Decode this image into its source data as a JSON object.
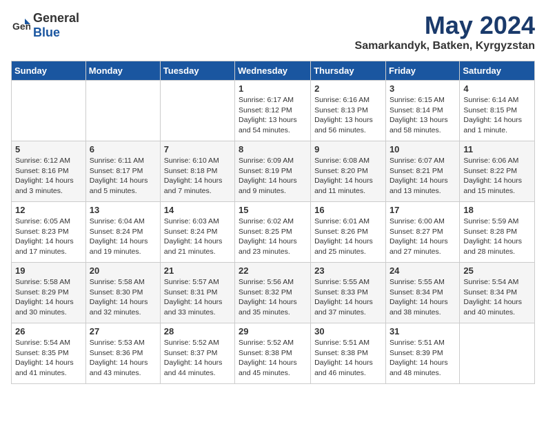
{
  "header": {
    "logo_general": "General",
    "logo_blue": "Blue",
    "month": "May 2024",
    "location": "Samarkandyk, Batken, Kyrgyzstan"
  },
  "weekdays": [
    "Sunday",
    "Monday",
    "Tuesday",
    "Wednesday",
    "Thursday",
    "Friday",
    "Saturday"
  ],
  "weeks": [
    [
      {
        "day": "",
        "info": ""
      },
      {
        "day": "",
        "info": ""
      },
      {
        "day": "",
        "info": ""
      },
      {
        "day": "1",
        "info": "Sunrise: 6:17 AM\nSunset: 8:12 PM\nDaylight: 13 hours\nand 54 minutes."
      },
      {
        "day": "2",
        "info": "Sunrise: 6:16 AM\nSunset: 8:13 PM\nDaylight: 13 hours\nand 56 minutes."
      },
      {
        "day": "3",
        "info": "Sunrise: 6:15 AM\nSunset: 8:14 PM\nDaylight: 13 hours\nand 58 minutes."
      },
      {
        "day": "4",
        "info": "Sunrise: 6:14 AM\nSunset: 8:15 PM\nDaylight: 14 hours\nand 1 minute."
      }
    ],
    [
      {
        "day": "5",
        "info": "Sunrise: 6:12 AM\nSunset: 8:16 PM\nDaylight: 14 hours\nand 3 minutes."
      },
      {
        "day": "6",
        "info": "Sunrise: 6:11 AM\nSunset: 8:17 PM\nDaylight: 14 hours\nand 5 minutes."
      },
      {
        "day": "7",
        "info": "Sunrise: 6:10 AM\nSunset: 8:18 PM\nDaylight: 14 hours\nand 7 minutes."
      },
      {
        "day": "8",
        "info": "Sunrise: 6:09 AM\nSunset: 8:19 PM\nDaylight: 14 hours\nand 9 minutes."
      },
      {
        "day": "9",
        "info": "Sunrise: 6:08 AM\nSunset: 8:20 PM\nDaylight: 14 hours\nand 11 minutes."
      },
      {
        "day": "10",
        "info": "Sunrise: 6:07 AM\nSunset: 8:21 PM\nDaylight: 14 hours\nand 13 minutes."
      },
      {
        "day": "11",
        "info": "Sunrise: 6:06 AM\nSunset: 8:22 PM\nDaylight: 14 hours\nand 15 minutes."
      }
    ],
    [
      {
        "day": "12",
        "info": "Sunrise: 6:05 AM\nSunset: 8:23 PM\nDaylight: 14 hours\nand 17 minutes."
      },
      {
        "day": "13",
        "info": "Sunrise: 6:04 AM\nSunset: 8:24 PM\nDaylight: 14 hours\nand 19 minutes."
      },
      {
        "day": "14",
        "info": "Sunrise: 6:03 AM\nSunset: 8:24 PM\nDaylight: 14 hours\nand 21 minutes."
      },
      {
        "day": "15",
        "info": "Sunrise: 6:02 AM\nSunset: 8:25 PM\nDaylight: 14 hours\nand 23 minutes."
      },
      {
        "day": "16",
        "info": "Sunrise: 6:01 AM\nSunset: 8:26 PM\nDaylight: 14 hours\nand 25 minutes."
      },
      {
        "day": "17",
        "info": "Sunrise: 6:00 AM\nSunset: 8:27 PM\nDaylight: 14 hours\nand 27 minutes."
      },
      {
        "day": "18",
        "info": "Sunrise: 5:59 AM\nSunset: 8:28 PM\nDaylight: 14 hours\nand 28 minutes."
      }
    ],
    [
      {
        "day": "19",
        "info": "Sunrise: 5:58 AM\nSunset: 8:29 PM\nDaylight: 14 hours\nand 30 minutes."
      },
      {
        "day": "20",
        "info": "Sunrise: 5:58 AM\nSunset: 8:30 PM\nDaylight: 14 hours\nand 32 minutes."
      },
      {
        "day": "21",
        "info": "Sunrise: 5:57 AM\nSunset: 8:31 PM\nDaylight: 14 hours\nand 33 minutes."
      },
      {
        "day": "22",
        "info": "Sunrise: 5:56 AM\nSunset: 8:32 PM\nDaylight: 14 hours\nand 35 minutes."
      },
      {
        "day": "23",
        "info": "Sunrise: 5:55 AM\nSunset: 8:33 PM\nDaylight: 14 hours\nand 37 minutes."
      },
      {
        "day": "24",
        "info": "Sunrise: 5:55 AM\nSunset: 8:34 PM\nDaylight: 14 hours\nand 38 minutes."
      },
      {
        "day": "25",
        "info": "Sunrise: 5:54 AM\nSunset: 8:34 PM\nDaylight: 14 hours\nand 40 minutes."
      }
    ],
    [
      {
        "day": "26",
        "info": "Sunrise: 5:54 AM\nSunset: 8:35 PM\nDaylight: 14 hours\nand 41 minutes."
      },
      {
        "day": "27",
        "info": "Sunrise: 5:53 AM\nSunset: 8:36 PM\nDaylight: 14 hours\nand 43 minutes."
      },
      {
        "day": "28",
        "info": "Sunrise: 5:52 AM\nSunset: 8:37 PM\nDaylight: 14 hours\nand 44 minutes."
      },
      {
        "day": "29",
        "info": "Sunrise: 5:52 AM\nSunset: 8:38 PM\nDaylight: 14 hours\nand 45 minutes."
      },
      {
        "day": "30",
        "info": "Sunrise: 5:51 AM\nSunset: 8:38 PM\nDaylight: 14 hours\nand 46 minutes."
      },
      {
        "day": "31",
        "info": "Sunrise: 5:51 AM\nSunset: 8:39 PM\nDaylight: 14 hours\nand 48 minutes."
      },
      {
        "day": "",
        "info": ""
      }
    ]
  ]
}
